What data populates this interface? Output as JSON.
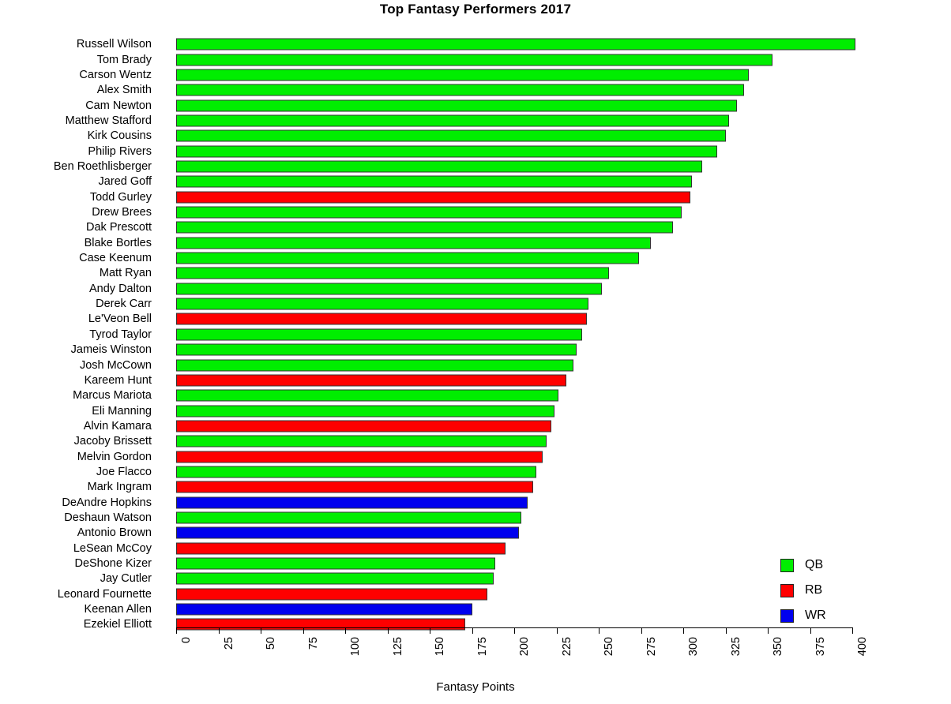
{
  "chart_data": {
    "type": "bar",
    "orientation": "horizontal",
    "title": "Top Fantasy Performers 2017",
    "xlabel": "Fantasy Points",
    "ylabel": "",
    "xlim": [
      0,
      400
    ],
    "xticks": [
      0,
      25,
      50,
      75,
      100,
      125,
      150,
      175,
      200,
      225,
      250,
      275,
      300,
      325,
      350,
      375,
      400
    ],
    "grid": false,
    "legend_position": "bottom-right",
    "legend": [
      {
        "label": "QB",
        "color": "#00EE00"
      },
      {
        "label": "RB",
        "color": "#FF0000"
      },
      {
        "label": "WR",
        "color": "#0000EE"
      }
    ],
    "categories": [
      "Russell Wilson",
      "Tom Brady",
      "Carson Wentz",
      "Alex Smith",
      "Cam Newton",
      "Matthew Stafford",
      "Kirk Cousins",
      "Philip Rivers",
      "Ben Roethlisberger",
      "Jared Goff",
      "Todd Gurley",
      "Drew Brees",
      "Dak Prescott",
      "Blake Bortles",
      "Case Keenum",
      "Matt Ryan",
      "Andy Dalton",
      "Derek Carr",
      "Le'Veon Bell",
      "Tyrod Taylor",
      "Jameis Winston",
      "Josh McCown",
      "Kareem Hunt",
      "Marcus Mariota",
      "Eli Manning",
      "Alvin Kamara",
      "Jacoby Brissett",
      "Melvin Gordon",
      "Joe Flacco",
      "Mark Ingram",
      "DeAndre Hopkins",
      "Deshaun Watson",
      "Antonio Brown",
      "LeSean McCoy",
      "DeShone Kizer",
      "Jay Cutler",
      "Leonard Fournette",
      "Keenan Allen",
      "Ezekiel Elliott"
    ],
    "values": [
      402,
      353,
      339,
      336,
      332,
      327,
      325,
      320,
      311,
      305,
      304,
      299,
      294,
      281,
      274,
      256,
      252,
      244,
      243,
      240,
      237,
      235,
      231,
      226,
      224,
      222,
      219,
      217,
      213,
      211,
      208,
      204,
      203,
      195,
      189,
      188,
      184,
      175,
      171
    ],
    "positions": [
      "QB",
      "QB",
      "QB",
      "QB",
      "QB",
      "QB",
      "QB",
      "QB",
      "QB",
      "QB",
      "RB",
      "QB",
      "QB",
      "QB",
      "QB",
      "QB",
      "QB",
      "QB",
      "RB",
      "QB",
      "QB",
      "QB",
      "RB",
      "QB",
      "QB",
      "RB",
      "QB",
      "RB",
      "QB",
      "RB",
      "WR",
      "QB",
      "WR",
      "RB",
      "QB",
      "QB",
      "RB",
      "WR",
      "RB"
    ]
  }
}
